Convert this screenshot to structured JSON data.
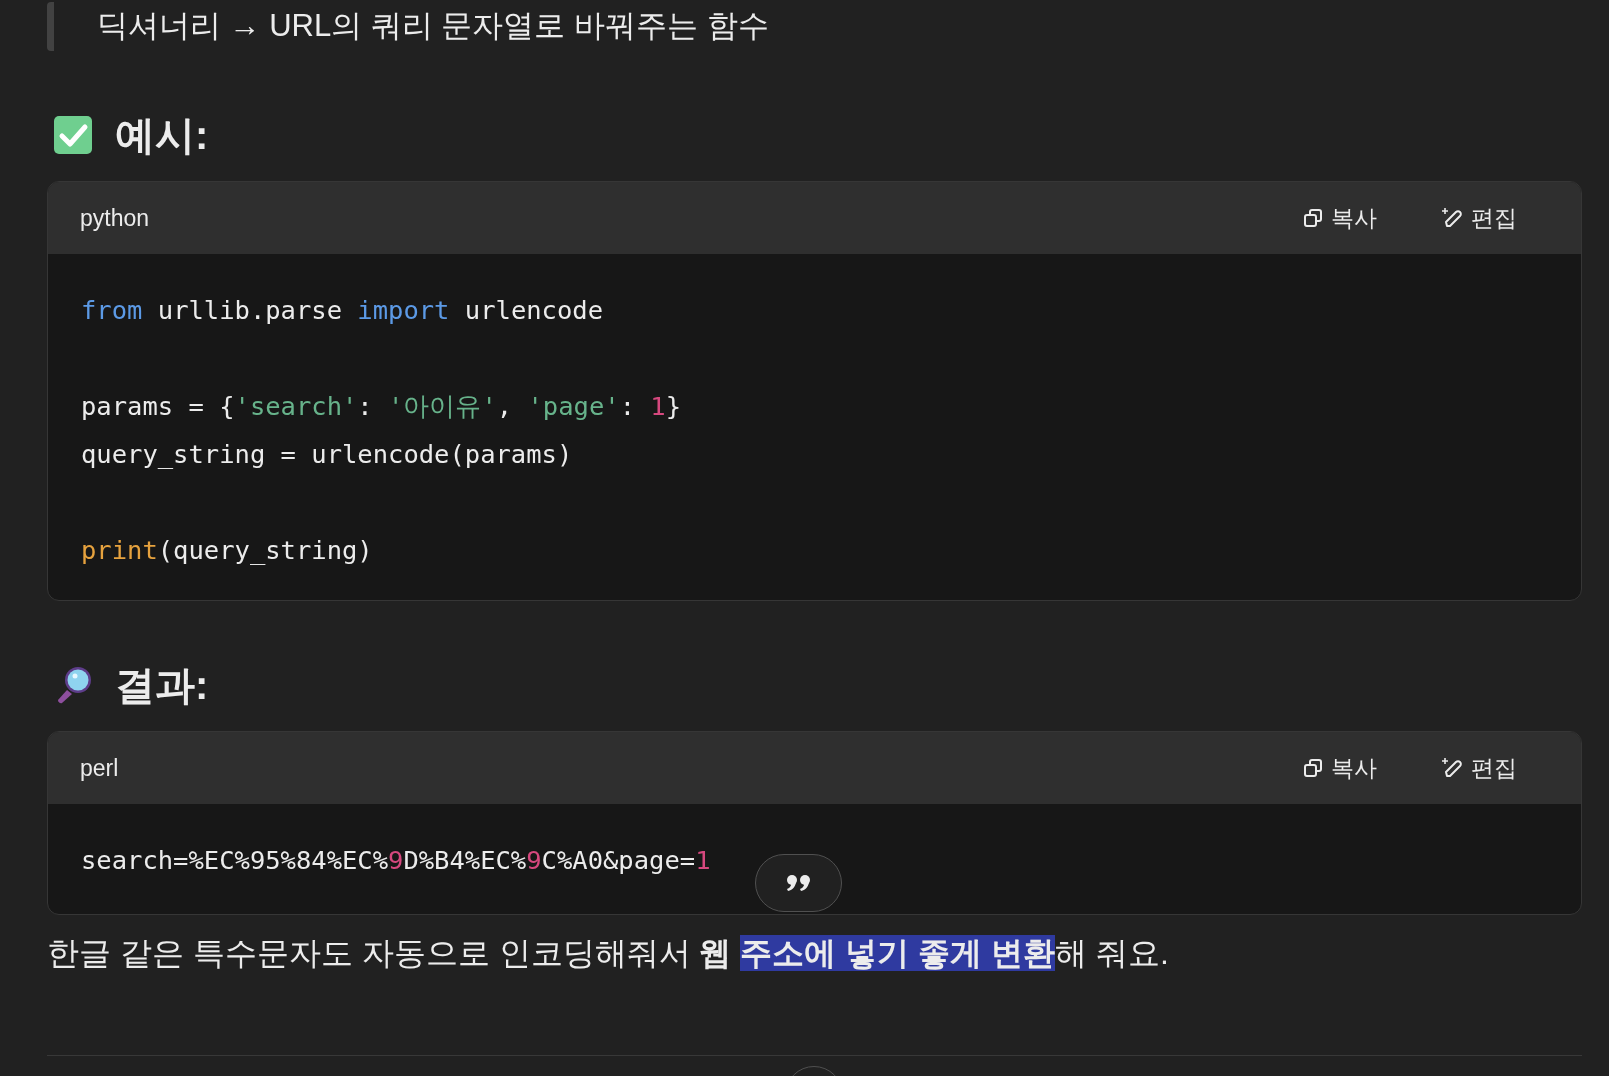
{
  "blockquote": {
    "text": "딕셔너리 → URL의 쿼리 문자열로 바꿔주는 함수"
  },
  "sections": [
    {
      "heading": {
        "text": "예시:"
      },
      "code": {
        "language": "python",
        "copy_label": "복사",
        "edit_label": "편집",
        "groups": [
          [
            [
              {
                "kind": "keyword",
                "text": "from"
              },
              {
                "kind": "plain",
                "text": " urllib.parse "
              },
              {
                "kind": "keyword",
                "text": "import"
              },
              {
                "kind": "plain",
                "text": " urlencode"
              }
            ]
          ],
          [
            [
              {
                "kind": "plain",
                "text": "params = {"
              },
              {
                "kind": "string",
                "text": "'search'"
              },
              {
                "kind": "plain",
                "text": ": "
              },
              {
                "kind": "string",
                "text": "'아이유'"
              },
              {
                "kind": "plain",
                "text": ", "
              },
              {
                "kind": "string",
                "text": "'page'"
              },
              {
                "kind": "plain",
                "text": ": "
              },
              {
                "kind": "number",
                "text": "1"
              },
              {
                "kind": "plain",
                "text": "}"
              }
            ],
            [
              {
                "kind": "plain",
                "text": "query_string = urlencode(params)"
              }
            ]
          ],
          [
            [
              {
                "kind": "builtin",
                "text": "print"
              },
              {
                "kind": "plain",
                "text": "(query_string)"
              }
            ]
          ]
        ]
      }
    },
    {
      "heading": {
        "text": "결과:"
      },
      "code": {
        "language": "perl",
        "copy_label": "복사",
        "edit_label": "편집",
        "groups": [
          [
            [
              {
                "kind": "plain",
                "text": "search=%EC%95%84%EC%"
              },
              {
                "kind": "number",
                "text": "9"
              },
              {
                "kind": "plain",
                "text": "D%B4%EC%"
              },
              {
                "kind": "number",
                "text": "9"
              },
              {
                "kind": "plain",
                "text": "C%A0&page="
              },
              {
                "kind": "number",
                "text": "1"
              }
            ]
          ]
        ]
      }
    }
  ],
  "paragraph": [
    {
      "text": "한글 같은 특수문자도 자동으로 인코딩해줘서 ",
      "bold": false,
      "selected": false
    },
    {
      "text": "웹 ",
      "bold": true,
      "selected": false
    },
    {
      "text": "주소에 넣기 좋게 변환",
      "bold": true,
      "selected": true
    },
    {
      "text": "해 줘요.",
      "bold": false,
      "selected": false
    }
  ]
}
